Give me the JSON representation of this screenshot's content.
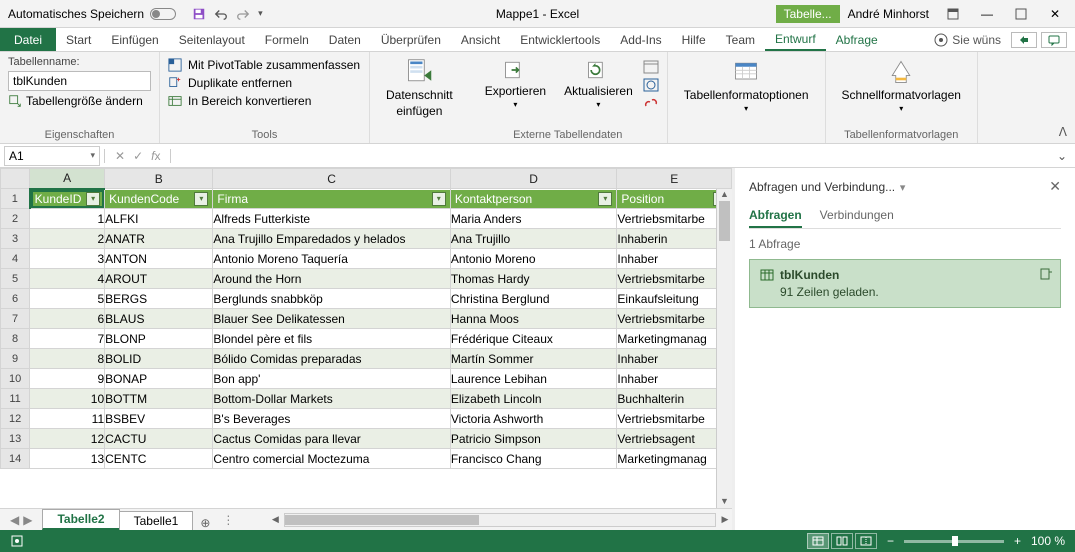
{
  "autosave_label": "Automatisches Speichern",
  "window_title": "Mappe1 - Excel",
  "context_tab_title": "Tabelle...",
  "user_name": "André Minhorst",
  "ribbon_tabs": {
    "file": "Datei",
    "items": [
      "Start",
      "Einfügen",
      "Seitenlayout",
      "Formeln",
      "Daten",
      "Überprüfen",
      "Ansicht",
      "Entwicklertools",
      "Add-Ins",
      "Hilfe",
      "Team"
    ],
    "context_items": [
      "Entwurf",
      "Abfrage"
    ],
    "tell_me": "Sie wüns"
  },
  "ribbon": {
    "props": {
      "name_label": "Tabellenname:",
      "table_name": "tblKunden",
      "resize": "Tabellengröße ändern",
      "group": "Eigenschaften"
    },
    "tools": {
      "pivot": "Mit PivotTable zusammenfassen",
      "dup": "Duplikate entfernen",
      "range": "In Bereich konvertieren",
      "group": "Tools"
    },
    "slicer": {
      "l1": "Datenschnitt",
      "l2": "einfügen"
    },
    "ext": {
      "export": "Exportieren",
      "refresh": "Aktualisieren",
      "group": "Externe Tabellendaten"
    },
    "styleopts": "Tabellenformatoptionen",
    "styles": {
      "btn": "Schnellformatvorlagen",
      "group": "Tabellenformatvorlagen"
    }
  },
  "namebox": "A1",
  "columns": [
    "A",
    "B",
    "C",
    "D",
    "E"
  ],
  "headers": [
    "KundeID",
    "KundenCode",
    "Firma",
    "Kontaktperson",
    "Position"
  ],
  "rows": [
    {
      "n": 1,
      "id": 1,
      "code": "ALFKI",
      "firma": "Alfreds Futterkiste",
      "kontakt": "Maria Anders",
      "pos": "Vertriebsmitarbe"
    },
    {
      "n": 2,
      "id": 2,
      "code": "ANATR",
      "firma": "Ana Trujillo Emparedados y helados",
      "kontakt": "Ana Trujillo",
      "pos": "Inhaberin"
    },
    {
      "n": 3,
      "id": 3,
      "code": "ANTON",
      "firma": "Antonio Moreno Taquería",
      "kontakt": "Antonio Moreno",
      "pos": "Inhaber"
    },
    {
      "n": 4,
      "id": 4,
      "code": "AROUT",
      "firma": "Around the Horn",
      "kontakt": "Thomas Hardy",
      "pos": "Vertriebsmitarbe"
    },
    {
      "n": 5,
      "id": 5,
      "code": "BERGS",
      "firma": "Berglunds snabbköp",
      "kontakt": "Christina Berglund",
      "pos": "Einkaufsleitung"
    },
    {
      "n": 6,
      "id": 6,
      "code": "BLAUS",
      "firma": "Blauer See Delikatessen",
      "kontakt": "Hanna Moos",
      "pos": "Vertriebsmitarbe"
    },
    {
      "n": 7,
      "id": 7,
      "code": "BLONP",
      "firma": "Blondel père et fils",
      "kontakt": "Frédérique Citeaux",
      "pos": "Marketingmanag"
    },
    {
      "n": 8,
      "id": 8,
      "code": "BOLID",
      "firma": "Bólido Comidas preparadas",
      "kontakt": "Martín Sommer",
      "pos": "Inhaber"
    },
    {
      "n": 9,
      "id": 9,
      "code": "BONAP",
      "firma": "Bon app'",
      "kontakt": "Laurence Lebihan",
      "pos": "Inhaber"
    },
    {
      "n": 10,
      "id": 10,
      "code": "BOTTM",
      "firma": "Bottom-Dollar Markets",
      "kontakt": "Elizabeth Lincoln",
      "pos": "Buchhalterin"
    },
    {
      "n": 11,
      "id": 11,
      "code": "BSBEV",
      "firma": "B's Beverages",
      "kontakt": "Victoria Ashworth",
      "pos": "Vertriebsmitarbe"
    },
    {
      "n": 12,
      "id": 12,
      "code": "CACTU",
      "firma": "Cactus Comidas para llevar",
      "kontakt": "Patricio Simpson",
      "pos": "Vertriebsagent"
    },
    {
      "n": 13,
      "id": 13,
      "code": "CENTC",
      "firma": "Centro comercial Moctezuma",
      "kontakt": "Francisco Chang",
      "pos": "Marketingmanag"
    }
  ],
  "sheets": {
    "active": "Tabelle2",
    "other": "Tabelle1"
  },
  "queries_panel": {
    "title": "Abfragen und Verbindung...",
    "tab_queries": "Abfragen",
    "tab_conn": "Verbindungen",
    "count": "1 Abfrage",
    "item_name": "tblKunden",
    "item_status": "91 Zeilen geladen."
  },
  "status": {
    "zoom": "100 %",
    "zoom_minus": "−",
    "zoom_plus": "+"
  }
}
